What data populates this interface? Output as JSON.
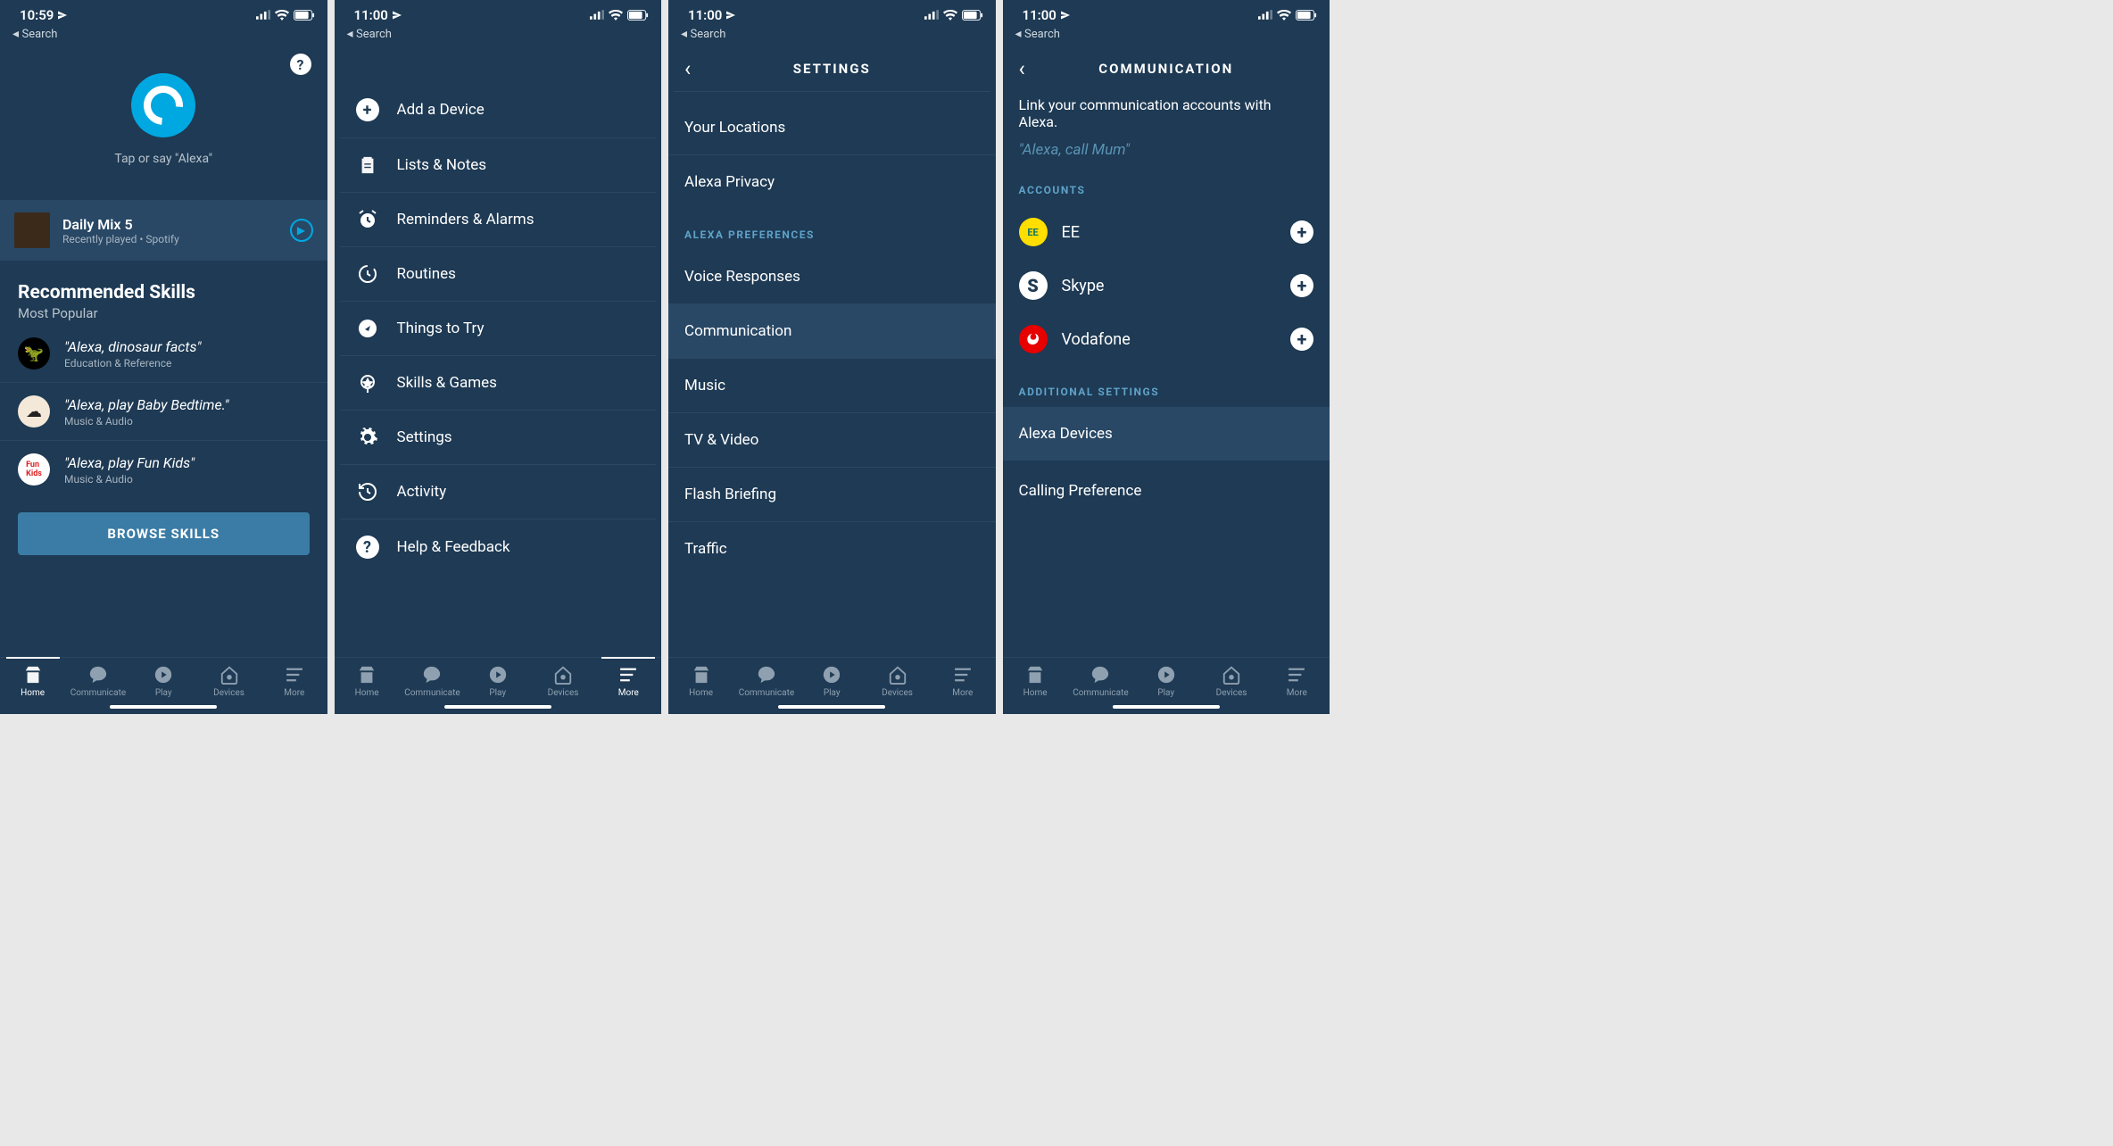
{
  "status": {
    "time1": "10:59",
    "time2": "11:00",
    "time3": "11:00",
    "time4": "11:00",
    "back_label": "Search"
  },
  "tabs": {
    "home": "Home",
    "communicate": "Communicate",
    "play": "Play",
    "devices": "Devices",
    "more": "More"
  },
  "screen1": {
    "tap_say": "Tap or say \"Alexa\"",
    "np_title": "Daily Mix 5",
    "np_subtitle": "Recently played • Spotify",
    "rec_title": "Recommended Skills",
    "rec_sub": "Most Popular",
    "skills": [
      {
        "say": "\"Alexa, dinosaur facts\"",
        "cat": "Education & Reference"
      },
      {
        "say": "\"Alexa, play Baby Bedtime.\"",
        "cat": "Music & Audio"
      },
      {
        "say": "\"Alexa, play Fun Kids\"",
        "cat": "Music & Audio"
      }
    ],
    "browse": "BROWSE SKILLS"
  },
  "screen2": {
    "items": [
      "Add a Device",
      "Lists & Notes",
      "Reminders & Alarms",
      "Routines",
      "Things to Try",
      "Skills & Games",
      "Settings",
      "Activity",
      "Help & Feedback"
    ]
  },
  "screen3": {
    "title": "SETTINGS",
    "items_top": [
      "Your Locations",
      "Alexa Privacy"
    ],
    "group1": "ALEXA PREFERENCES",
    "items_prefs": [
      "Voice Responses",
      "Communication",
      "Music",
      "TV & Video",
      "Flash Briefing",
      "Traffic"
    ]
  },
  "screen4": {
    "title": "COMMUNICATION",
    "desc": "Link your communication accounts with Alexa.",
    "hint": "\"Alexa, call Mum\"",
    "group_accounts": "ACCOUNTS",
    "accounts": [
      "EE",
      "Skype",
      "Vodafone"
    ],
    "group_additional": "ADDITIONAL SETTINGS",
    "additional": [
      "Alexa Devices",
      "Calling Preference"
    ]
  }
}
